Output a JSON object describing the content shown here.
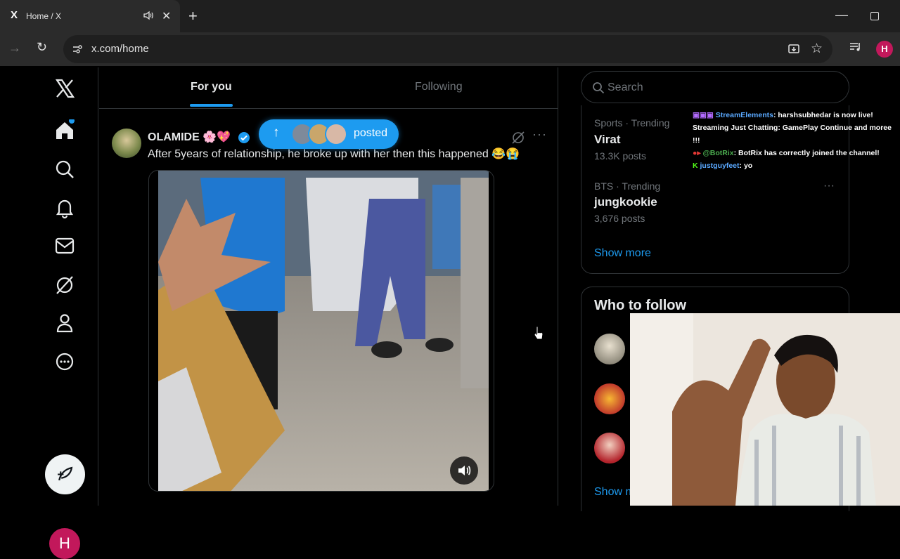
{
  "browser": {
    "tab_title": "Home / X",
    "tab_favicon": "X",
    "new_tab_glyph": "+",
    "url": "x.com/home",
    "profile_initial": "H"
  },
  "nav": {
    "items": [
      "x-logo-icon",
      "home-icon",
      "search-icon",
      "notifications-icon",
      "messages-icon",
      "grok-icon",
      "profile-icon",
      "more-icon"
    ],
    "avatar_initial": "H"
  },
  "main": {
    "tabs": [
      {
        "label": "For you",
        "active": true
      },
      {
        "label": "Following",
        "active": false
      }
    ],
    "posted_pill": {
      "label": "posted"
    },
    "tweet": {
      "author": "OLAMIDE 🌸💖",
      "text": "After 5years of relationship, he broke up with her then this happened 😂😭"
    }
  },
  "sidebar": {
    "search_placeholder": "Search",
    "trends": [
      {
        "meta": "Sports · Trending",
        "name": "Virat",
        "count": "13.3K posts"
      },
      {
        "meta": "BTS · Trending",
        "name": "jungkookie",
        "count": "3,676 posts"
      }
    ],
    "show_more": "Show more",
    "who_to_follow": {
      "title": "Who to follow",
      "show_more_partial": "Show m"
    }
  },
  "chat": [
    {
      "user": "StreamElements",
      "message": ": harshsubhedar is now live! Streaming Just Chatting: GamePlay Continue and moree !!!"
    },
    {
      "user": "@BotRix",
      "message": ": BotRix has correctly joined the channel!"
    },
    {
      "user": "justguyfeet",
      "message": ": yo"
    }
  ],
  "colors": {
    "accent": "#1d9bf0",
    "avatar": "#c2185b",
    "border": "#2f3336",
    "muted": "#71767b"
  }
}
